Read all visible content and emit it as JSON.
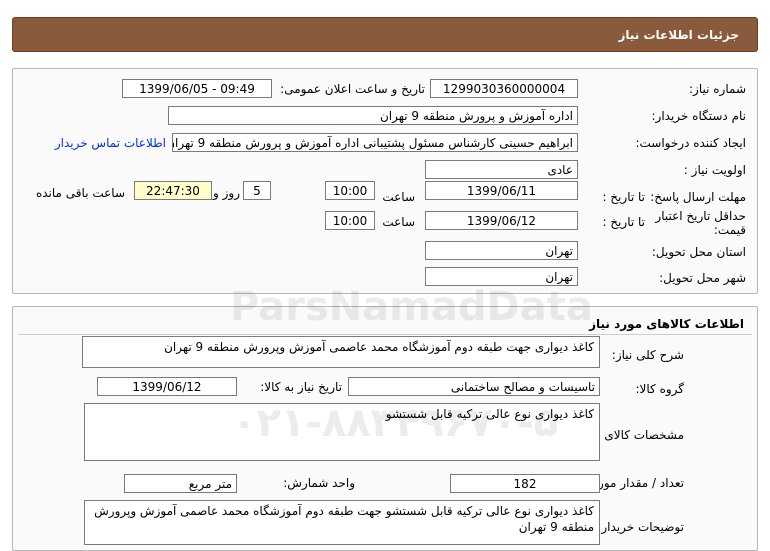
{
  "header": {
    "title": "جزئیات اطلاعات نیاز"
  },
  "info": {
    "need_number_label": "شماره نیاز:",
    "need_number": "1299030360000004",
    "announce_label": "تاریخ و ساعت اعلان عمومی:",
    "announce_value": "1399/06/05 - 09:49",
    "buyer_org_label": "نام دستگاه خریدار:",
    "buyer_org": "اداره آموزش و پرورش منطقه 9 تهران",
    "requester_label": "ایجاد کننده درخواست:",
    "requester": "ابراهیم حسینی کارشناس مسئول پشتیبانی اداره آموزش و پرورش منطقه 9 تهران",
    "contact_link": "اطلاعات تماس خریدار",
    "priority_label": "اولویت نیاز :",
    "priority": "عادی",
    "send_deadline_label": "مهلت ارسال پاسخ:",
    "to_date_label": "تا تاریخ :",
    "send_date": "1399/06/11",
    "time_label": "ساعت",
    "send_time": "10:00",
    "days": "5",
    "days_label": "روز و",
    "remaining_time": "22:47:30",
    "remaining_label": "ساعت باقی مانده",
    "validity_label": "حداقل تاریخ اعتبار قیمت:",
    "validity_date": "1399/06/12",
    "validity_time": "10:00",
    "province_label": "استان محل تحویل:",
    "province": "تهران",
    "city_label": "شهر محل تحویل:",
    "city": "تهران"
  },
  "goods": {
    "section_title": "اطلاعات کالاهای مورد نیاز",
    "summary_label": "شرح کلی نیاز:",
    "summary": "کاغذ دیواری جهت طبقه دوم آموزشگاه محمد عاصمی آموزش وپرورش منطقه 9 تهران",
    "group_label": "گروه کالا:",
    "group": "تاسیسات و مصالح ساختمانی",
    "need_date_label": "تاریخ نیاز به کالا:",
    "need_date": "1399/06/12",
    "spec_label": "مشخصات کالای مورد نیاز:",
    "spec": "کاغذ دیواری نوع عالی ترکیه قابل شستشو",
    "qty_label": "تعداد / مقدار مورد نیاز:",
    "qty": "182",
    "unit_label": "واحد شمارش:",
    "unit": "متر مربع",
    "buyer_notes_label": "توضیحات خریدار:",
    "buyer_notes": "کاغذ دیواری نوع عالی ترکیه قابل شستشو جهت طبقه دوم آموزشگاه محمد عاصمی آموزش وپرورش منطقه 9 تهران"
  },
  "watermark": {
    "brand": "ParsNamadData",
    "phone": "۰۲۱-۸۸۳۴۹۶۷۰-۵"
  }
}
